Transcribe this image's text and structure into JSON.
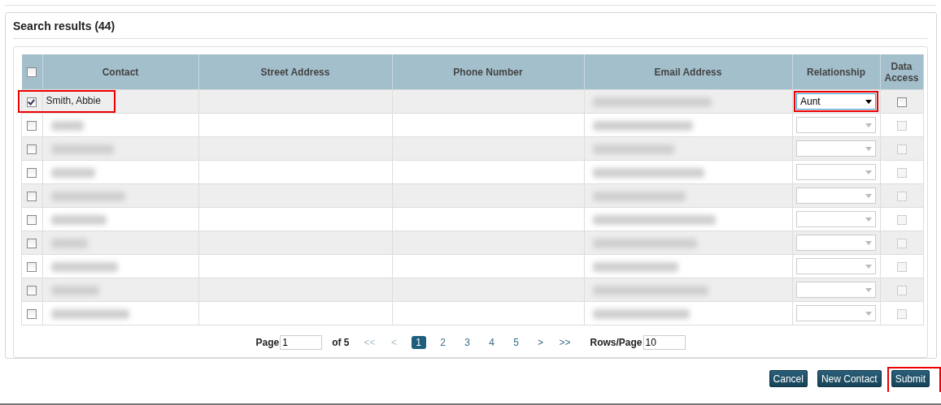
{
  "panel": {
    "title": "Search results (44)"
  },
  "table": {
    "columns": [
      "Contact",
      "Street Address",
      "Phone Number",
      "Email Address",
      "Relationship",
      "Data Access"
    ],
    "all_checked": false,
    "rows": [
      {
        "checked": true,
        "contact": "Smith, Abbie",
        "highlighted": true,
        "relationship": "Aunt",
        "relationship_highlighted": true,
        "disabled": false,
        "data_access": false
      },
      {
        "checked": false,
        "disabled": true,
        "data_access": false
      },
      {
        "checked": false,
        "disabled": true,
        "data_access": false
      },
      {
        "checked": false,
        "disabled": true,
        "data_access": false
      },
      {
        "checked": false,
        "disabled": true,
        "data_access": false
      },
      {
        "checked": false,
        "disabled": true,
        "data_access": false
      },
      {
        "checked": false,
        "disabled": true,
        "data_access": false
      },
      {
        "checked": false,
        "disabled": true,
        "data_access": false
      },
      {
        "checked": false,
        "disabled": true,
        "data_access": false
      },
      {
        "checked": false,
        "disabled": true,
        "data_access": false
      }
    ]
  },
  "pager": {
    "page_label": "Page",
    "page_value": "1",
    "of_label": "of 5",
    "first": "<<",
    "prev": "<",
    "pages": [
      {
        "label": "1",
        "selected": true
      },
      {
        "label": "2",
        "selected": false
      },
      {
        "label": "3",
        "selected": false
      },
      {
        "label": "4",
        "selected": false
      },
      {
        "label": "5",
        "selected": false
      }
    ],
    "next": ">",
    "last": ">>",
    "rows_label": "Rows/Page",
    "rows_value": "10"
  },
  "buttons": [
    {
      "label": "Cancel"
    },
    {
      "label": "New Contact"
    },
    {
      "label": "Submit",
      "highlighted": true
    }
  ]
}
